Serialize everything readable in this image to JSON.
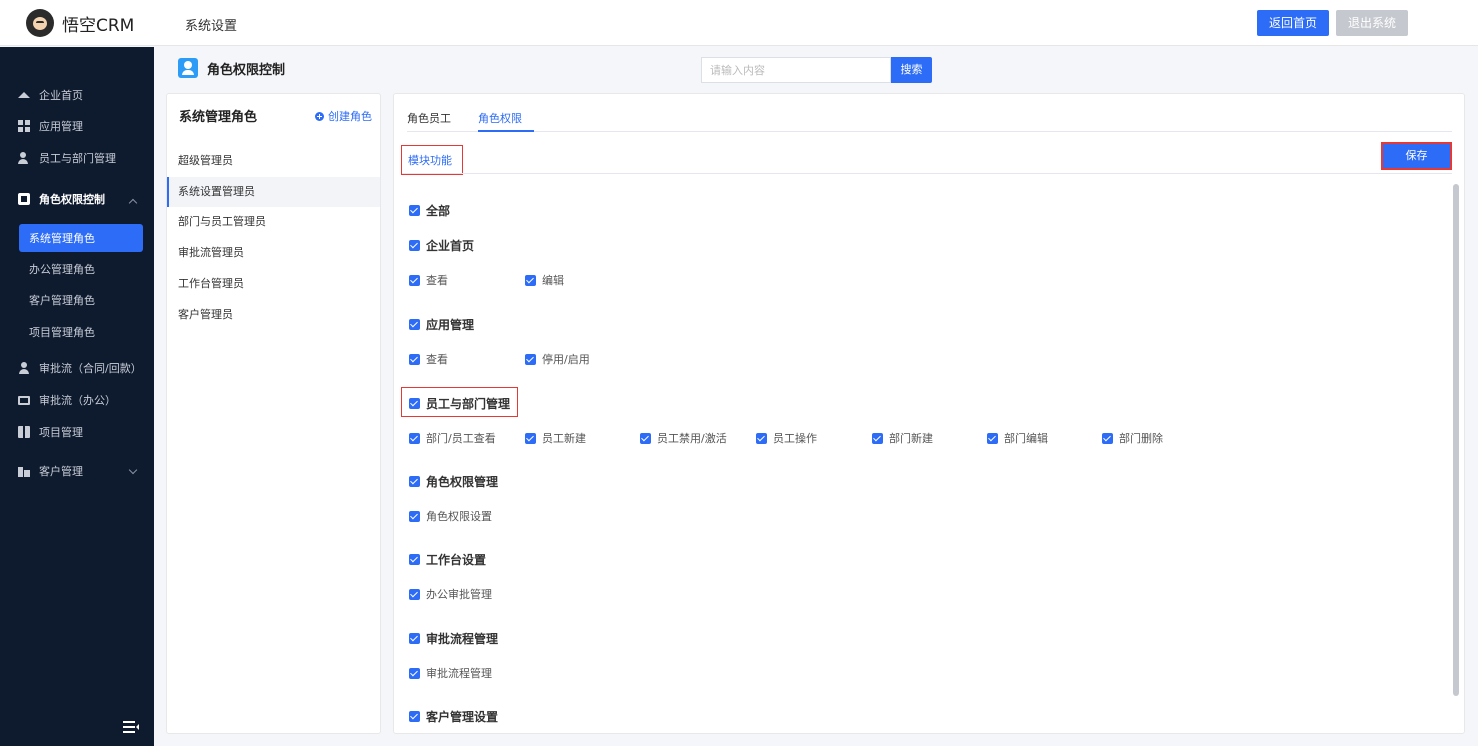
{
  "header": {
    "logo_text": "悟空CRM",
    "title": "系统设置",
    "home_label": "返回首页",
    "exit_label": "退出系统"
  },
  "sidebar": {
    "items": [
      {
        "label": "企业首页",
        "icon": "home-icon"
      },
      {
        "label": "应用管理",
        "icon": "grid-icon"
      },
      {
        "label": "员工与部门管理",
        "icon": "users-icon"
      },
      {
        "label": "角色权限控制",
        "icon": "role-icon",
        "expanded": true
      },
      {
        "label": "审批流（合同/回款）",
        "icon": "person-icon"
      },
      {
        "label": "审批流（办公）",
        "icon": "monitor-icon"
      },
      {
        "label": "项目管理",
        "icon": "board-icon"
      },
      {
        "label": "客户管理",
        "icon": "building-icon"
      }
    ],
    "sub_items": [
      "系统管理角色",
      "办公管理角色",
      "客户管理角色",
      "项目管理角色"
    ],
    "active_sub": "系统管理角色"
  },
  "page": {
    "title": "角色权限控制",
    "search_placeholder": "请输入内容",
    "search_label": "搜索"
  },
  "roles_panel": {
    "title": "系统管理角色",
    "create_label": "创建角色",
    "roles": [
      "超级管理员",
      "系统设置管理员",
      "部门与员工管理员",
      "审批流管理员",
      "工作台管理员",
      "客户管理员"
    ],
    "active_role": "系统设置管理员"
  },
  "main_panel": {
    "tabs": [
      "角色员工",
      "角色权限"
    ],
    "active_tab": "角色权限",
    "module_tab": "模块功能",
    "save_label": "保存",
    "all_label": "全部",
    "groups": [
      {
        "label": "企业首页",
        "options": [
          "查看",
          "编辑"
        ]
      },
      {
        "label": "应用管理",
        "options": [
          "查看",
          "停用/启用"
        ]
      },
      {
        "label": "员工与部门管理",
        "options": [
          "部门/员工查看",
          "员工新建",
          "员工禁用/激活",
          "员工操作",
          "部门新建",
          "部门编辑",
          "部门删除"
        ]
      },
      {
        "label": "角色权限管理",
        "options": [
          "角色权限设置"
        ]
      },
      {
        "label": "工作台设置",
        "options": [
          "办公审批管理"
        ]
      },
      {
        "label": "审批流程管理",
        "options": [
          "审批流程管理"
        ]
      },
      {
        "label": "客户管理设置",
        "options": []
      }
    ]
  },
  "colors": {
    "primary": "#2d6cf6",
    "sidebar_bg": "#0e1a2e",
    "highlight": "#e53935"
  }
}
